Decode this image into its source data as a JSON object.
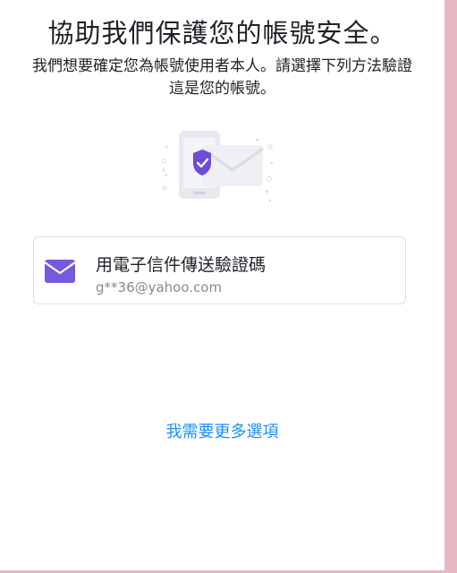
{
  "header": {
    "title": "協助我們保護您的帳號安全。",
    "subtitle": "我們想要確定您為帳號使用者本人。請選擇下列方法驗證這是您的帳號。"
  },
  "illustration": {
    "icon": "phone-email-shield-icon",
    "accent_color": "#6e4bd8"
  },
  "options": [
    {
      "label": "用電子信件傳送驗證碼",
      "detail": "g**36@yahoo.com",
      "icon": "envelope-icon",
      "icon_color": "#7759e0"
    }
  ],
  "more_options": {
    "label": "我需要更多選項",
    "color": "#188fff"
  },
  "colors": {
    "background": "#e6b8c3",
    "panel": "#ffffff",
    "text": "#1d2228",
    "muted": "#828a93"
  }
}
